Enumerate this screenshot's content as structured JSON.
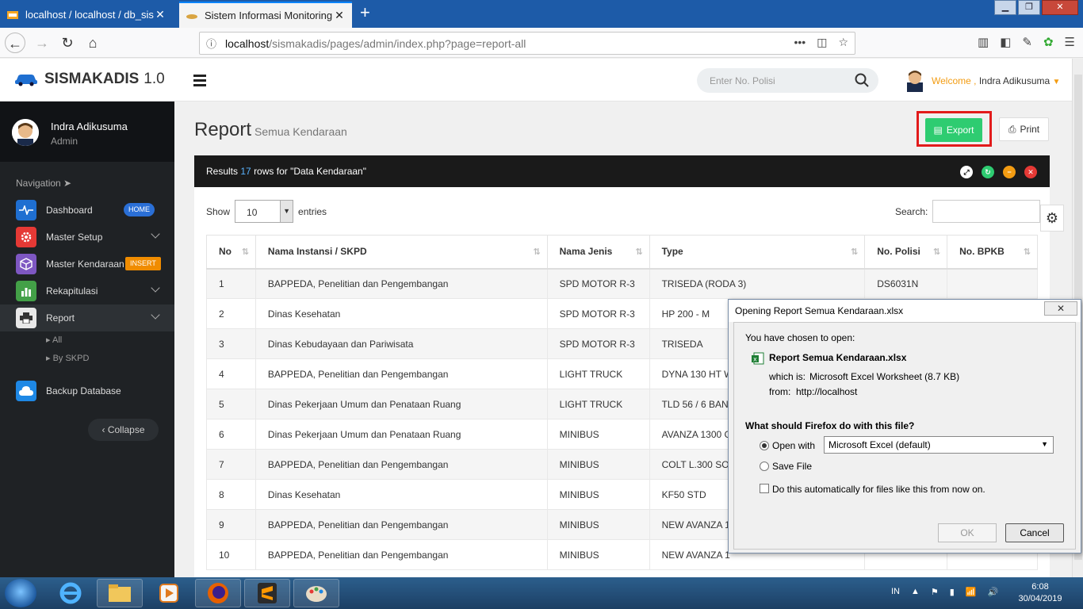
{
  "browser": {
    "tabs": [
      {
        "label": "localhost / localhost / db_sismak"
      },
      {
        "label": "Sistem Informasi Monitoring A"
      }
    ],
    "url_host": "localhost",
    "url_path": "/sismakadis/pages/admin/index.php?page=report-all"
  },
  "header": {
    "brand": "SISMAKADIS",
    "version": "1.0",
    "search_placeholder": "Enter No. Polisi",
    "welcome_label": "Welcome ,",
    "user_name": "Indra Adikusuma"
  },
  "sidebar": {
    "profile_name": "Indra Adikusuma",
    "profile_role": "Admin",
    "nav_heading": "Navigation",
    "items": [
      {
        "label": "Dashboard",
        "badge": "HOME"
      },
      {
        "label": "Master Setup"
      },
      {
        "label": "Master Kendaraan",
        "badge": "INSERT"
      },
      {
        "label": "Rekapitulasi"
      },
      {
        "label": "Report"
      },
      {
        "label": "Backup Database"
      }
    ],
    "report_sub": [
      "All",
      "By SKPD"
    ],
    "collapse": "Collapse"
  },
  "main": {
    "title": "Report",
    "subtitle": "Semua Kendaraan",
    "export_label": "Export",
    "print_label": "Print",
    "results": {
      "prefix": "Results",
      "count": "17",
      "suffix": "rows for \"Data Kendaraan\""
    },
    "show_label": "Show",
    "show_value": "10",
    "entries_label": "entries",
    "search_label": "Search:",
    "columns": [
      "No",
      "Nama Instansi / SKPD",
      "Nama Jenis",
      "Type",
      "No. Polisi",
      "No. BPKB"
    ],
    "rows": [
      [
        "1",
        "BAPPEDA, Penelitian dan Pengembangan",
        "SPD MOTOR R-3",
        "TRISEDA (RODA 3)",
        "DS6031N",
        ""
      ],
      [
        "2",
        "Dinas Kesehatan",
        "SPD MOTOR R-3",
        "HP 200 - M",
        "",
        ""
      ],
      [
        "3",
        "Dinas Kebudayaan dan Pariwisata",
        "SPD MOTOR R-3",
        "TRISEDA",
        "",
        ""
      ],
      [
        "4",
        "BAPPEDA, Penelitian dan Pengembangan",
        "LIGHT TRUCK",
        "DYNA 130 HT W",
        "",
        ""
      ],
      [
        "5",
        "Dinas Pekerjaan Umum dan Penataan Ruang",
        "LIGHT TRUCK",
        "TLD 56 / 6 BAN",
        "",
        ""
      ],
      [
        "6",
        "Dinas Pekerjaan Umum dan Penataan Ruang",
        "MINIBUS",
        "AVANZA 1300 G",
        "",
        ""
      ],
      [
        "7",
        "BAPPEDA, Penelitian dan Pengembangan",
        "MINIBUS",
        "COLT L.300 SOL",
        "",
        ""
      ],
      [
        "8",
        "Dinas Kesehatan",
        "MINIBUS",
        "KF50 STD",
        "",
        ""
      ],
      [
        "9",
        "BAPPEDA, Penelitian dan Pengembangan",
        "MINIBUS",
        "NEW AVANZA 1",
        "",
        ""
      ],
      [
        "10",
        "BAPPEDA, Penelitian dan Pengembangan",
        "MINIBUS",
        "NEW AVANZA 1",
        "",
        ""
      ]
    ]
  },
  "dialog": {
    "title": "Opening Report Semua Kendaraan.xlsx",
    "chosen_label": "You have chosen to open:",
    "file_name": "Report Semua Kendaraan.xlsx",
    "which_label": "which is:",
    "which_value": "Microsoft Excel Worksheet (8.7 KB)",
    "from_label": "from:",
    "from_value": "http://localhost",
    "question": "What should Firefox do with this file?",
    "open_with_label": "Open with",
    "open_with_value": "Microsoft Excel (default)",
    "save_label": "Save File",
    "auto_label": "Do this automatically for files like this from now on.",
    "ok_label": "OK",
    "cancel_label": "Cancel"
  },
  "taskbar": {
    "lang": "IN",
    "time": "6:08",
    "date": "30/04/2019"
  },
  "colors": {
    "export_green": "#2ecc71",
    "highlight_red": "#e21b1b",
    "accent_orange": "#f39c12",
    "sidebar_dark": "#1f2225"
  }
}
